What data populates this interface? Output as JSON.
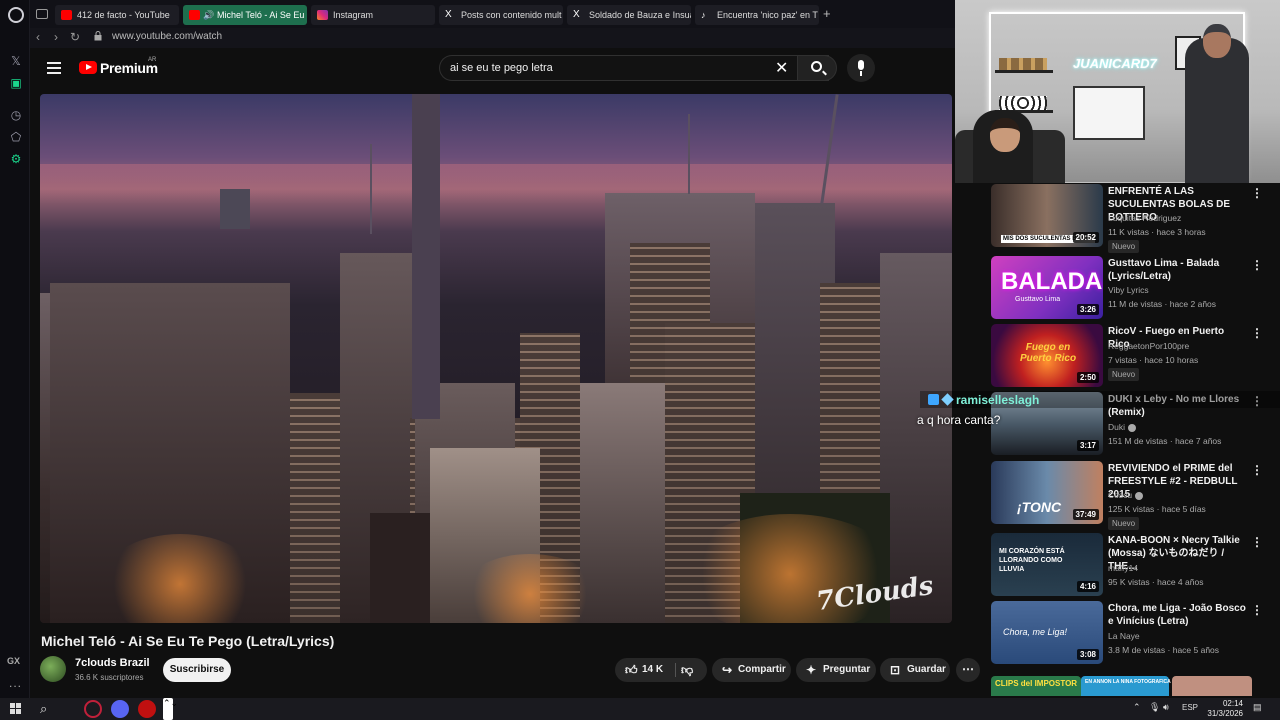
{
  "browser": {
    "tabs": [
      {
        "label": "412 de facto - YouTube",
        "icon": "youtube-icon"
      },
      {
        "label": "Michel Teló - Ai Se Eu",
        "icon": "youtube-icon",
        "active": true
      },
      {
        "label": "Instagram",
        "icon": "instagram-icon"
      },
      {
        "label": "Posts con contenido mult",
        "icon": "x-icon"
      },
      {
        "label": "Soldado de Bauza e Insua",
        "icon": "x-icon"
      },
      {
        "label": "Encuentra 'nico paz' en T",
        "icon": "tiktok-icon"
      }
    ],
    "new_tab": "+",
    "url": "www.youtube.com/watch",
    "sidebar_label": "GX",
    "sidebar_more": "..."
  },
  "youtube": {
    "logo": "Premium",
    "country": "AR",
    "search_value": "ai se eu te pego letra",
    "clear": "✕"
  },
  "video": {
    "title": "Michel Teló - Ai Se Eu Te Pego (Letra/Lyrics)",
    "watermark": "7Clouds",
    "channel": "7clouds Brazil",
    "subscribers": "36.6 K suscriptores",
    "subscribe_label": "Suscribirse",
    "likes": "14 K",
    "share_label": "Compartir",
    "ask_label": "Preguntar",
    "save_label": "Guardar",
    "more": "⋯"
  },
  "webcam": {
    "sign": "JUANICARD7"
  },
  "chat": {
    "username": "ramiselleslagh",
    "message": "a q hora canta?"
  },
  "recommendations": [
    {
      "title": "ENFRENTÉ A LAS SUCULENTAS BOLAS DE BOTTERO",
      "channel": "Luquitas Rodriguez",
      "meta": "11 K vistas · hace 3 horas",
      "duration": "20:52",
      "badge": "Nuevo",
      "thumb_text": "MIS DOS SUCULENTAS BOLAS"
    },
    {
      "title": "Gusttavo Lima - Balada (Lyrics/Letra)",
      "channel": "Viby Lyrics",
      "meta": "11 M de vistas · hace 2 años",
      "duration": "3:26",
      "thumb_text": "BALADA",
      "thumb_sub": "Gusttavo Lima"
    },
    {
      "title": "RicoV - Fuego en Puerto Rico",
      "channel": "ReggaetonPor100pre",
      "meta": "7 vistas · hace 10 horas",
      "duration": "2:50",
      "badge": "Nuevo",
      "thumb_text": "Fuego en Puerto Rico"
    },
    {
      "title": "DUKI x Leby - No me Llores (Remix)",
      "channel": "Duki",
      "meta": "151 M de vistas · hace 7 años",
      "duration": "3:17",
      "verified": true
    },
    {
      "title": "REVIVIENDO el PRIME del FREESTYLE #2 - REDBULL 2015",
      "channel": "Coscu",
      "meta": "125 K vistas · hace 5 días",
      "duration": "37:49",
      "badge": "Nuevo",
      "verified": true,
      "thumb_text": "¡TONC"
    },
    {
      "title": "KANA-BOON × Necry Talkie (Mossa) ないものねだり / THE…",
      "channel": "maffy14",
      "meta": "95 K vistas · hace 4 años",
      "duration": "4:16",
      "thumb_text": "MI CORAZÓN ESTÁ LLORANDO COMO LLUVIA"
    },
    {
      "title": "Chora, me Liga - João Bosco e Vinícius (Letra)",
      "channel": "La Naye",
      "meta": "3.8 M de vistas · hace 5 años",
      "duration": "3:08",
      "thumb_text": "Chora, me Liga!"
    }
  ],
  "bottom_strip": {
    "left": "CLIPS del IMPOSTOR",
    "middle": "EN ANNON LA NINA FOTOGRAFICA"
  },
  "taskbar": {
    "lang": "ESP",
    "time": "02:14",
    "date": "31/3/2026"
  }
}
